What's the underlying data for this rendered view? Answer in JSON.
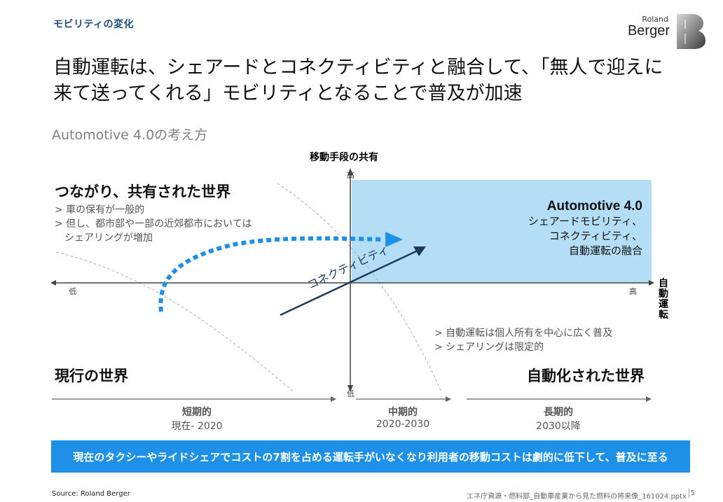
{
  "header": {
    "section_label": "モビリティの変化",
    "logo_line1": "Roland",
    "logo_line2": "Berger",
    "headline_line1": "自動運転は、シェアードとコネクティビティと融合して、「無人で迎えに",
    "headline_line2": "来て送ってくれる」モビリティとなることで普及が加速"
  },
  "subtitle": "Automotive 4.0の考え方",
  "diagram": {
    "y_axis_title": "移動手段の共有",
    "y_high": "高",
    "y_low": "低",
    "x_axis_title": "自動運転",
    "x_low": "低",
    "x_high": "高",
    "connectivity_label": "コネクティビティ",
    "quadrant_top_left": {
      "title": "つながり、共有された世界",
      "bullets": [
        "> 車の保有が一般的",
        "> 但し、都市部や一部の近郊都市においては",
        "シェアリングが増加"
      ]
    },
    "quadrant_top_right": {
      "title": "Automotive 4.0",
      "lines": [
        "シェアードモビリティ、",
        "コネクティビティ、",
        "自動運転の融合"
      ]
    },
    "quadrant_bottom_right": {
      "bullets": [
        "> 自動運転は個人所有を中心に広く普及",
        "> シェアリングは限定的"
      ],
      "title": "自動化された世界"
    },
    "quadrant_bottom_left": {
      "title": "現行の世界"
    },
    "colors": {
      "accent_blue": "#1e90e8",
      "box_fill": "#b3def5",
      "dark_navy": "#1f3b5c"
    }
  },
  "timeline": [
    {
      "name": "短期的",
      "years": "現在- 2020"
    },
    {
      "name": "中期的",
      "years": "2020-2030"
    },
    {
      "name": "長期的",
      "years": "2030以降"
    }
  ],
  "banner": "現在のタクシーやライドシェアでコストの7割を占める運転手がいなくなり利用者の移動コストは劇的に低下して、普及に至る",
  "footer": {
    "source": "Source: Roland Berger",
    "file": "エネ庁資源・燃料部_自動車産業から見た燃料の将来像_161024.pptx",
    "page": "5"
  }
}
